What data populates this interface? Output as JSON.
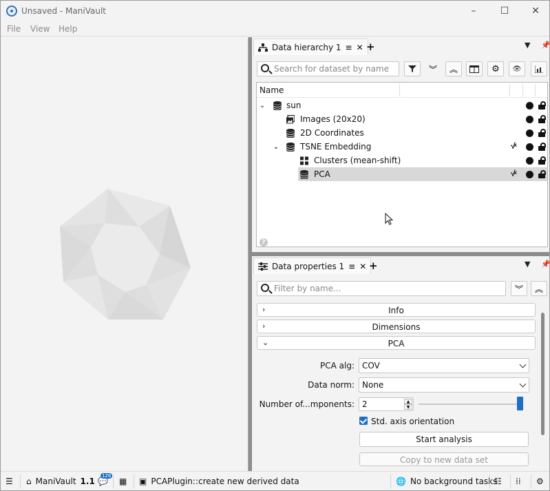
{
  "window": {
    "title": "Unsaved - ManiVault",
    "controls": {
      "minimize": "–",
      "maximize": "☐",
      "close": "✕"
    }
  },
  "menubar": {
    "items": [
      "File",
      "View",
      "Help"
    ]
  },
  "hierarchy_panel": {
    "tab_label": "Data hierarchy 1",
    "search_placeholder": "Search for dataset by name",
    "column_header": "Name",
    "rows": [
      {
        "label": "sun",
        "icon": "database-icon",
        "expanded": true
      },
      {
        "label": "Images (20x20)",
        "icon": "images-icon"
      },
      {
        "label": "2D Coordinates",
        "icon": "database-icon"
      },
      {
        "label": "TSNE Embedding",
        "icon": "database-icon",
        "expanded": true
      },
      {
        "label": "Clusters (mean-shift)",
        "icon": "clusters-icon"
      },
      {
        "label": "PCA",
        "icon": "database-icon",
        "selected": true
      }
    ]
  },
  "properties_panel": {
    "tab_label": "Data properties 1",
    "filter_placeholder": "Filter by name...",
    "sections": [
      {
        "label": "Info",
        "expanded": false
      },
      {
        "label": "Dimensions",
        "expanded": false
      },
      {
        "label": "PCA",
        "expanded": true
      }
    ],
    "pca": {
      "alg_label": "PCA alg:",
      "alg_value": "COV",
      "norm_label": "Data norm:",
      "norm_value": "None",
      "components_label": "Number of...mponents:",
      "components_value": "2",
      "components_slider_fraction": 1.0,
      "std_axis_label": "Std. axis orientation",
      "std_axis_checked": true,
      "start_button": "Start analysis",
      "copy_button": "Copy to new data set"
    }
  },
  "statusbar": {
    "app_name": "ManiVault",
    "version": "1.1",
    "notification_count": "126",
    "message": "PCAPlugin::create new derived data",
    "tasks": "No background tasks"
  },
  "colors": {
    "accent": "#1c6fc5",
    "splitter": "#8c8c8c",
    "selected_row": "#d8d8d8"
  }
}
